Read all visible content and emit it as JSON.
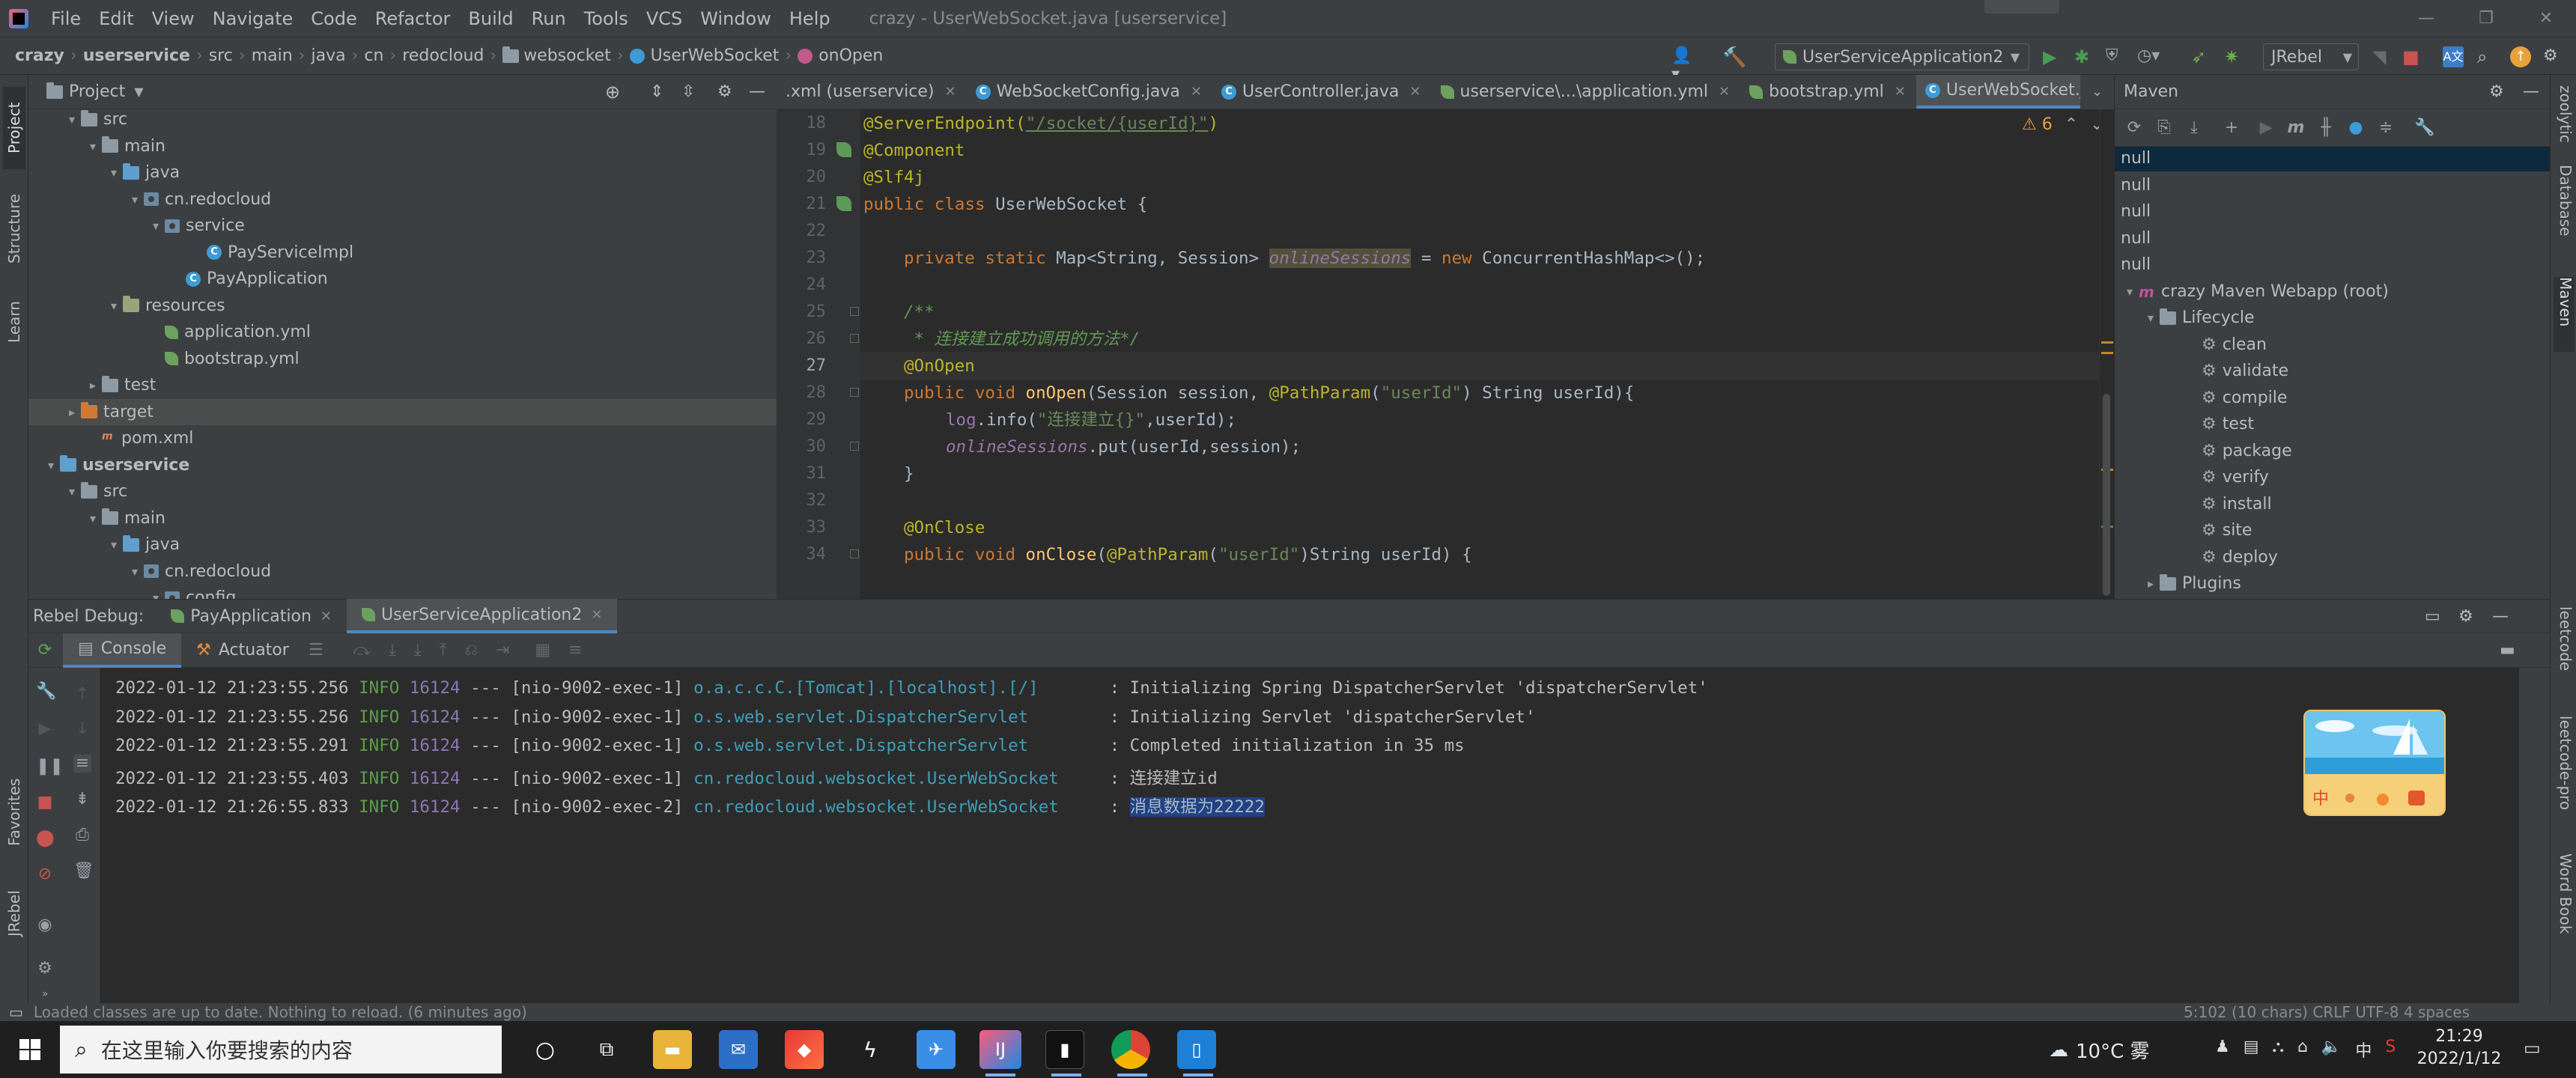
{
  "menu": {
    "items": [
      "File",
      "Edit",
      "View",
      "Navigate",
      "Code",
      "Refactor",
      "Build",
      "Run",
      "Tools",
      "VCS",
      "Window",
      "Help"
    ],
    "window_title": "crazy - UserWebSocket.java [userservice]"
  },
  "breadcrumbs": [
    "crazy",
    "userservice",
    "src",
    "main",
    "java",
    "cn",
    "redocloud",
    "websocket",
    "UserWebSocket",
    "onOpen"
  ],
  "toolbar": {
    "run_config": "UserServiceApplication2",
    "jrebel": "JRebel"
  },
  "left_strip": [
    "Project",
    "Structure",
    "Learn",
    "Favorites",
    "JRebel"
  ],
  "project": {
    "title": "Project",
    "tree": [
      {
        "indent": 1,
        "arrow": "▾",
        "icon": "folder-gray",
        "label": "src"
      },
      {
        "indent": 2,
        "arrow": "▾",
        "icon": "folder-gray",
        "label": "main"
      },
      {
        "indent": 3,
        "arrow": "▾",
        "icon": "folder-blue",
        "label": "java"
      },
      {
        "indent": 4,
        "arrow": "▾",
        "icon": "package",
        "label": "cn.redocloud"
      },
      {
        "indent": 5,
        "arrow": "▾",
        "icon": "package",
        "label": "service"
      },
      {
        "indent": 7,
        "arrow": "",
        "icon": "class",
        "label": "PayServiceImpl"
      },
      {
        "indent": 6,
        "arrow": "",
        "icon": "class",
        "label": "PayApplication"
      },
      {
        "indent": 3,
        "arrow": "▾",
        "icon": "folder-res",
        "label": "resources"
      },
      {
        "indent": 5,
        "arrow": "",
        "icon": "spring",
        "label": "application.yml"
      },
      {
        "indent": 5,
        "arrow": "",
        "icon": "spring",
        "label": "bootstrap.yml"
      },
      {
        "indent": 2,
        "arrow": "▸",
        "icon": "folder-gray",
        "label": "test"
      },
      {
        "indent": 1,
        "arrow": "▸",
        "icon": "folder-orange",
        "label": "target",
        "selected": true
      },
      {
        "indent": 2,
        "arrow": "",
        "icon": "pom",
        "label": "pom.xml"
      },
      {
        "indent": 0,
        "arrow": "▾",
        "icon": "folder-blue",
        "label": "userservice",
        "bold": true
      },
      {
        "indent": 1,
        "arrow": "▾",
        "icon": "folder-gray",
        "label": "src"
      },
      {
        "indent": 2,
        "arrow": "▾",
        "icon": "folder-gray",
        "label": "main"
      },
      {
        "indent": 3,
        "arrow": "▾",
        "icon": "folder-blue",
        "label": "java"
      },
      {
        "indent": 4,
        "arrow": "▾",
        "icon": "package",
        "label": "cn.redocloud"
      },
      {
        "indent": 5,
        "arrow": "▾",
        "icon": "package",
        "label": "config"
      }
    ]
  },
  "editor": {
    "tabs": [
      {
        "label": ".xml (userservice)",
        "icon": "xml"
      },
      {
        "label": "WebSocketConfig.java",
        "icon": "class"
      },
      {
        "label": "UserController.java",
        "icon": "class"
      },
      {
        "label": "userservice\\...\\application.yml",
        "icon": "spring"
      },
      {
        "label": "bootstrap.yml",
        "icon": "spring"
      },
      {
        "label": "UserWebSocket.java",
        "icon": "class",
        "active": true
      }
    ],
    "warnings": "⚠ 6",
    "line_numbers": [
      "18",
      "19",
      "20",
      "21",
      "22",
      "23",
      "24",
      "25",
      "26",
      "27",
      "28",
      "29",
      "30",
      "31",
      "32",
      "33",
      "34"
    ],
    "current_line": "27",
    "code": {
      "l18_ann": "@ServerEndpoint(",
      "l18_str": "\"/socket/{userId}\"",
      "l18_end": ")",
      "l19": "@Component",
      "l20": "@Slf4j",
      "l21_kw": "public class",
      "l21_rest": " UserWebSocket {",
      "l23_kw": "private static",
      "l23_type": " Map<String, Session> ",
      "l23_field": "onlineSessions",
      "l23_eq": " = ",
      "l23_new": "new",
      "l23_rest": " ConcurrentHashMap<>();",
      "l25": "/**",
      "l26": " * 连接建立成功调用的方法*/",
      "l27": "@OnOpen",
      "l28_kw": "public void",
      "l28_m": " onOpen",
      "l28_a": "(Session session, ",
      "l28_ann": "@PathParam",
      "l28_b": "(",
      "l28_str": "\"userId\"",
      "l28_c": ") String userId){",
      "l29_log": "log",
      "l29_a": ".info(",
      "l29_str": "\"连接建立{}\"",
      "l29_b": ",userId);",
      "l30_field": "onlineSessions",
      "l30_rest": ".put(userId,session);",
      "l31": "}",
      "l33": "@OnClose",
      "l34_kw": "public void",
      "l34_m": " onClose",
      "l34_a": "(",
      "l34_ann": "@PathParam",
      "l34_b": "(",
      "l34_str": "\"userId\"",
      "l34_c": ")String userId) {"
    }
  },
  "maven": {
    "title": "Maven",
    "tree": [
      {
        "indent": 0,
        "arrow": "",
        "icon": "",
        "label": "null",
        "selected": true
      },
      {
        "indent": 0,
        "arrow": "",
        "icon": "",
        "label": "null"
      },
      {
        "indent": 0,
        "arrow": "",
        "icon": "",
        "label": "null"
      },
      {
        "indent": 0,
        "arrow": "",
        "icon": "",
        "label": "null"
      },
      {
        "indent": 0,
        "arrow": "",
        "icon": "",
        "label": "null"
      },
      {
        "indent": 0,
        "arrow": "▾",
        "icon": "maven",
        "label": "crazy Maven Webapp (root)"
      },
      {
        "indent": 1,
        "arrow": "▾",
        "icon": "folder",
        "label": "Lifecycle"
      },
      {
        "indent": 3,
        "arrow": "",
        "icon": "gear",
        "label": "clean"
      },
      {
        "indent": 3,
        "arrow": "",
        "icon": "gear",
        "label": "validate"
      },
      {
        "indent": 3,
        "arrow": "",
        "icon": "gear",
        "label": "compile"
      },
      {
        "indent": 3,
        "arrow": "",
        "icon": "gear",
        "label": "test"
      },
      {
        "indent": 3,
        "arrow": "",
        "icon": "gear",
        "label": "package"
      },
      {
        "indent": 3,
        "arrow": "",
        "icon": "gear",
        "label": "verify"
      },
      {
        "indent": 3,
        "arrow": "",
        "icon": "gear",
        "label": "install"
      },
      {
        "indent": 3,
        "arrow": "",
        "icon": "gear",
        "label": "site"
      },
      {
        "indent": 3,
        "arrow": "",
        "icon": "gear",
        "label": "deploy"
      },
      {
        "indent": 1,
        "arrow": "▸",
        "icon": "folder",
        "label": "Plugins"
      }
    ]
  },
  "right_strip": [
    "zoolytic",
    "Database",
    "Maven",
    "leetcode",
    "leetcode-pro",
    "Word Book"
  ],
  "debug": {
    "label": "Rebel Debug:",
    "tabs": [
      {
        "label": "PayApplication"
      },
      {
        "label": "UserServiceApplication2",
        "active": true
      }
    ],
    "subtabs": [
      "Console",
      "Actuator"
    ],
    "logs": [
      {
        "ts": "2022-01-12 21:23:55.256",
        "level": "INFO",
        "pid": "16124",
        "sep": "---",
        "thread": "[nio-9002-exec-1]",
        "logger": "o.a.c.c.C.[Tomcat].[localhost].[/]      ",
        "msg": ": Initializing Spring DispatcherServlet 'dispatcherServlet'"
      },
      {
        "ts": "2022-01-12 21:23:55.256",
        "level": "INFO",
        "pid": "16124",
        "sep": "---",
        "thread": "[nio-9002-exec-1]",
        "logger": "o.s.web.servlet.DispatcherServlet       ",
        "msg": ": Initializing Servlet 'dispatcherServlet'"
      },
      {
        "ts": "2022-01-12 21:23:55.291",
        "level": "INFO",
        "pid": "16124",
        "sep": "---",
        "thread": "[nio-9002-exec-1]",
        "logger": "o.s.web.servlet.DispatcherServlet       ",
        "msg": ": Completed initialization in 35 ms"
      },
      {
        "ts": "2022-01-12 21:23:55.403",
        "level": "INFO",
        "pid": "16124",
        "sep": "---",
        "thread": "[nio-9002-exec-1]",
        "logger": "cn.redocloud.websocket.UserWebSocket    ",
        "msg": ": 连接建立id"
      },
      {
        "ts": "2022-01-12 21:26:55.833",
        "level": "INFO",
        "pid": "16124",
        "sep": "---",
        "thread": "[nio-9002-exec-2]",
        "logger": "cn.redocloud.websocket.UserWebSocket    ",
        "msg": ": ",
        "selected_msg": "消息数据为22222"
      }
    ]
  },
  "status": {
    "left": "Loaded classes are up to date. Nothing to reload. (6 minutes ago)",
    "right": "5:102 (10 chars)   CRLF   UTF-8   4 spaces"
  },
  "taskbar": {
    "search_placeholder": "在这里输入你要搜索的内容",
    "weather": "10°C 雾",
    "ime": "中",
    "time": "21:29",
    "date": "2022/1/12"
  },
  "colors": {
    "accent": "#4a88c7",
    "panel": "#3c3f41",
    "editor_bg": "#2b2b2b"
  }
}
